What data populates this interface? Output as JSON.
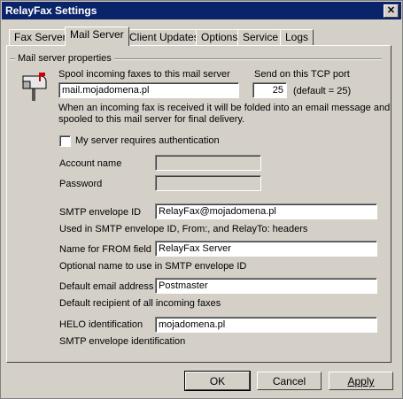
{
  "window": {
    "title": "RelayFax Settings",
    "close_glyph": "✕"
  },
  "tabs": [
    {
      "label": "Fax Server"
    },
    {
      "label": "Mail Server"
    },
    {
      "label": "Client Updates"
    },
    {
      "label": "Options"
    },
    {
      "label": "Service"
    },
    {
      "label": "Logs"
    }
  ],
  "group": {
    "title": "Mail server properties"
  },
  "spool": {
    "label": "Spool incoming faxes to this mail server",
    "value": "mail.mojadomena.pl"
  },
  "port": {
    "label": "Send on this TCP port",
    "value": "25",
    "hint": "(default = 25)"
  },
  "description": {
    "line1": "When an incoming fax is received it will be folded into an email message and",
    "line2": "spooled to this mail server for final delivery."
  },
  "auth": {
    "label": "My server requires authentication",
    "checked": false
  },
  "account": {
    "label": "Account name",
    "value": ""
  },
  "password": {
    "label": "Password",
    "value": ""
  },
  "smtp_envelope": {
    "label": "SMTP envelope ID",
    "value": "RelayFax@mojadomena.pl",
    "hint": "Used in SMTP envelope ID, From:, and RelayTo: headers"
  },
  "from_name": {
    "label": "Name for FROM field",
    "value": "RelayFax Server",
    "hint": "Optional name to use in SMTP envelope ID"
  },
  "default_email": {
    "label": "Default email address",
    "value": "Postmaster",
    "hint": "Default recipient of all incoming faxes"
  },
  "helo": {
    "label": "HELO identification",
    "value": "mojadomena.pl",
    "hint": "SMTP envelope identification"
  },
  "buttons": {
    "ok": "OK",
    "cancel": "Cancel",
    "apply": "Apply"
  },
  "icons": {
    "mailbox": "mailbox-icon"
  }
}
